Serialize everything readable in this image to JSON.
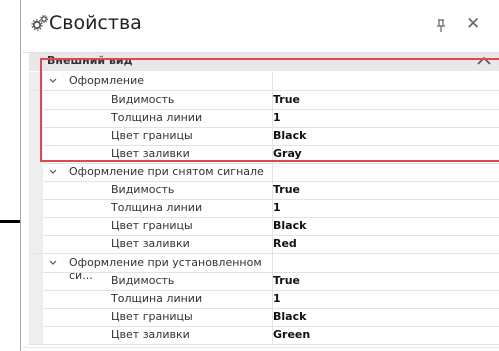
{
  "panel": {
    "title": "Свойства",
    "icons": {
      "title": "gears-icon",
      "pin": "pin-icon",
      "close": "close-icon",
      "collapse": "chevron-up-icon",
      "group_toggle": "chevron-down-icon"
    },
    "category": "Внешний вид",
    "groups": [
      {
        "label": "Оформление",
        "rows": [
          {
            "name": "Видимость",
            "value": "True"
          },
          {
            "name": "Толщина линии",
            "value": "1"
          },
          {
            "name": "Цвет границы",
            "value": "Black"
          },
          {
            "name": "Цвет заливки",
            "value": "Gray"
          }
        ]
      },
      {
        "label": "Оформление при снятом сигнале",
        "rows": [
          {
            "name": "Видимость",
            "value": "True"
          },
          {
            "name": "Толщина линии",
            "value": "1"
          },
          {
            "name": "Цвет границы",
            "value": "Black"
          },
          {
            "name": "Цвет заливки",
            "value": "Red"
          }
        ]
      },
      {
        "label": "Оформление при установленном си...",
        "rows": [
          {
            "name": "Видимость",
            "value": "True"
          },
          {
            "name": "Толщина линии",
            "value": "1"
          },
          {
            "name": "Цвет границы",
            "value": "Black"
          },
          {
            "name": "Цвет заливки",
            "value": "Green"
          }
        ]
      }
    ]
  },
  "highlight_color": "#e2474f"
}
